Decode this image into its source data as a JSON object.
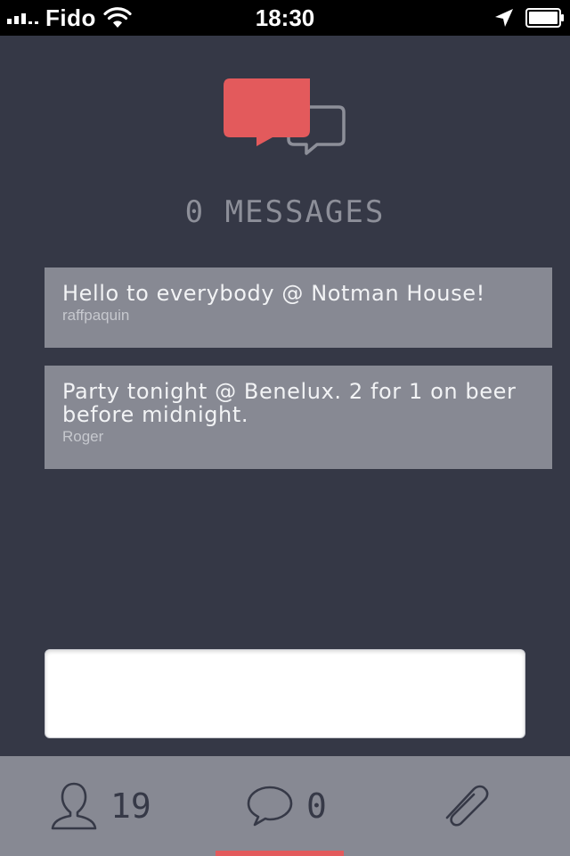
{
  "status_bar": {
    "carrier": "Fido",
    "time": "18:30"
  },
  "header": {
    "message_count_label": "0 MESSAGES",
    "logo_icon": "chat-bubbles-icon",
    "accent_color": "#e35a5c"
  },
  "messages": [
    {
      "text": "Hello to everybody @ Notman House!",
      "author": "raffpaquin"
    },
    {
      "text": "Party tonight @ Benelux. 2 for 1 on beer before midnight.",
      "author": "Roger"
    }
  ],
  "compose": {
    "value": "",
    "placeholder": ""
  },
  "tabbar": {
    "people": {
      "icon": "person-icon",
      "count": "19"
    },
    "chat": {
      "icon": "speech-bubble-icon",
      "count": "0",
      "selected": true
    },
    "attach": {
      "icon": "paperclip-icon"
    }
  }
}
